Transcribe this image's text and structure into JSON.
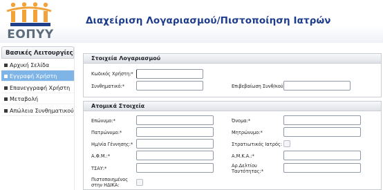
{
  "header": {
    "logo_text": "ΕΟΠΥΥ",
    "title": "Διαχείριση Λογαριασμού/Πιστοποίηση Ιατρών"
  },
  "sidebar": {
    "heading": "Βασικές Λειτουργίες",
    "items": [
      {
        "label": "Αρχική Σελίδα",
        "active": false
      },
      {
        "label": "Εγγραφή Χρήστη",
        "active": true
      },
      {
        "label": "Επανεγγραφή Χρήστη",
        "active": false
      },
      {
        "label": "Μεταβολή",
        "active": false
      },
      {
        "label": "Απώλεια Συνθηματικού",
        "active": false
      }
    ]
  },
  "account": {
    "heading": "Στοιχεία Λογαριασμού",
    "username_label": "Κωδικός Χρήστη:*",
    "username_value": "",
    "password_label": "Συνθηματικό:*",
    "password_value": "",
    "confirm_label": "Επιβεβαίωση Συνθ/κού:*",
    "confirm_value": ""
  },
  "personal": {
    "heading": "Ατομικά Στοιχεία",
    "surname_label": "Επώνυμο:*",
    "name_label": "Όνομα:*",
    "father_label": "Πατρώνυμο:*",
    "mother_label": "Μητρώνυμο:*",
    "birthdate_label": "Ημ/νία Γέννησης:*",
    "military_label": "Στρατιωτικός Ιατρός:",
    "afm_label": "Α.Φ.Μ.:*",
    "amka_label": "Α.Μ.Κ.Α.:*",
    "tsay_label": "ΤΣΑΥ:*",
    "id_label": "Αρ.Δελτίου Ταυτότητας:*",
    "certified_label": "Πιστοποιημένος στην ΗΔΙΚΑ:"
  },
  "colors": {
    "title_blue": "#1d3c8c",
    "active_item": "#7fb4e6",
    "logo_blue": "#1f3f8a",
    "logo_orange": "#f2a23a"
  }
}
